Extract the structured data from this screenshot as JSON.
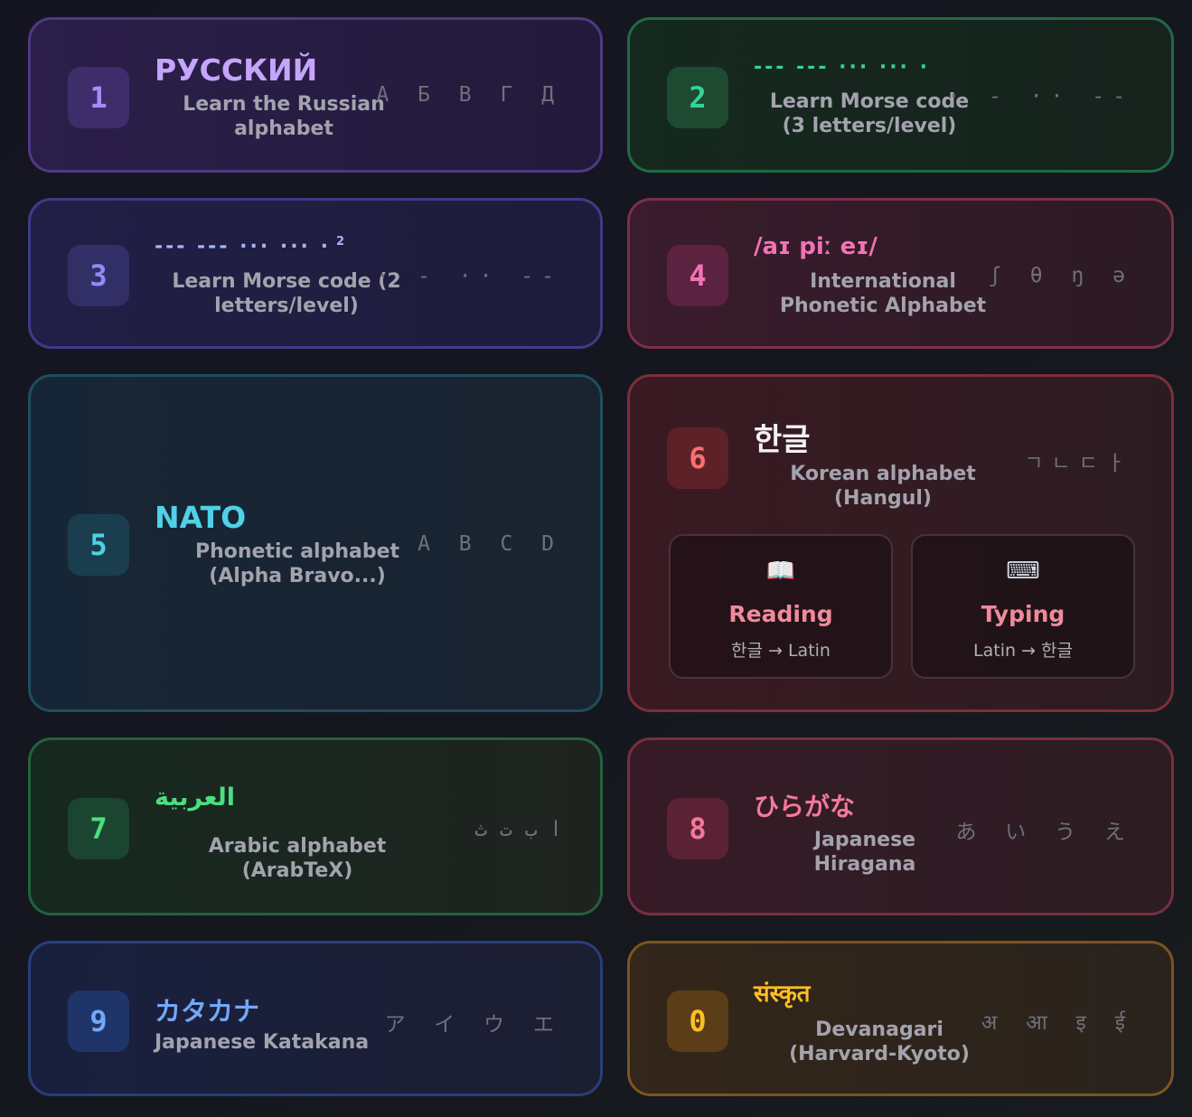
{
  "cards": [
    {
      "key": "1",
      "title": "РУССКИЙ",
      "subtitle": "Learn the Russian alphabet",
      "preview": "А Б В Г Д"
    },
    {
      "key": "2",
      "title": "--- --- ··· ··· ·",
      "subtitle": "Learn Morse code (3 letters/level)",
      "preview": "· - ·· --"
    },
    {
      "key": "3",
      "title": "--- --- ··· ··· ·",
      "title_sup": "2",
      "subtitle": "Learn Morse code (2 letters/level)",
      "preview": "· - ·· --"
    },
    {
      "key": "4",
      "title": "/aɪ piː eɪ/",
      "subtitle": "International Phonetic Alphabet",
      "preview": "ʃ θ ŋ ə"
    },
    {
      "key": "5",
      "title": "NATO",
      "subtitle": "Phonetic alphabet (Alpha Bravo...)",
      "preview": "A B C D"
    },
    {
      "key": "6",
      "title": "한글",
      "subtitle": "Korean alphabet (Hangul)",
      "preview": "ㄱㄴㄷㅏ",
      "modes": [
        {
          "icon": "📖",
          "label": "Reading",
          "desc": "한글 → Latin"
        },
        {
          "icon": "⌨",
          "label": "Typing",
          "desc": "Latin → 한글"
        }
      ]
    },
    {
      "key": "7",
      "title": "العربية",
      "subtitle": "Arabic alphabet (ArabTeX)",
      "preview": "ا ب ت ث"
    },
    {
      "key": "8",
      "title": "ひらがな",
      "subtitle": "Japanese Hiragana",
      "preview": "あ い う え"
    },
    {
      "key": "9",
      "title": "カタカナ",
      "subtitle": "Japanese Katakana",
      "preview": "ア イ ウ エ"
    },
    {
      "key": "0",
      "title": "संस्कृत",
      "subtitle": "Devanagari (Harvard-Kyoto)",
      "preview": "अ आ इ ई"
    }
  ],
  "colors": {
    "purple": "#a78bfa",
    "green": "#34d399",
    "indigo": "#8f8cf8",
    "pink": "#f472b6",
    "cyan": "#4fd1e6",
    "red": "#f87171",
    "teal": "#4ade80",
    "rose": "#f4789a",
    "blue": "#74a7f7",
    "amber": "#fbbf24"
  }
}
